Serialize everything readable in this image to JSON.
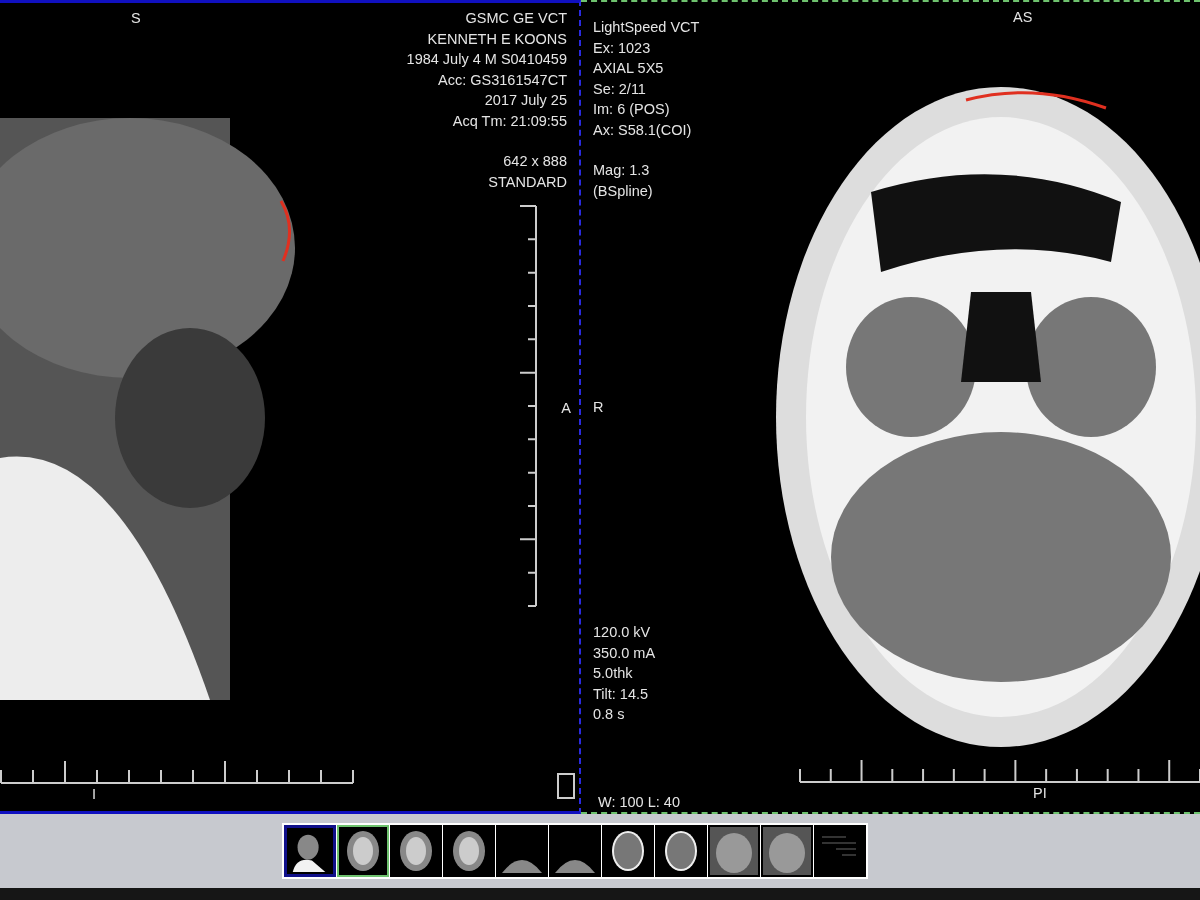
{
  "viewports": [
    {
      "kind": "xray",
      "selected": true,
      "orientation": [
        {
          "kind": "top",
          "text": "S"
        },
        {
          "kind": "right",
          "text": "A"
        },
        {
          "kind": "bottom",
          "text": "I"
        }
      ],
      "info_groups": [
        [
          "GSMC GE VCT",
          "KENNETH E KOONS",
          "1984 July 4 M S0410459",
          "Acc: GS3161547CT",
          "2017 July 25",
          "Acq Tm: 21:09:55"
        ],
        [
          "642 x 888",
          "STANDARD"
        ]
      ]
    },
    {
      "kind": "ct",
      "selected": false,
      "orientation": [
        {
          "kind": "top",
          "text": "AS"
        },
        {
          "kind": "left",
          "text": "R"
        },
        {
          "kind": "bottom",
          "text": "PI"
        }
      ],
      "info_groups": [
        [
          "LightSpeed VCT",
          "Ex: 1023",
          "AXIAL 5X5",
          "Se: 2/11",
          "Im: 6 (POS)",
          "Ax: S58.1(COI)"
        ],
        [
          "Mag: 1.3",
          "(BSpline)"
        ]
      ],
      "bottom_info": [
        "120.0 kV",
        "350.0 mA",
        "5.0thk",
        "Tilt: 14.5",
        "0.8 s"
      ],
      "window_level": "W: 100 L: 40"
    }
  ],
  "thumbnails": [
    {
      "kind": "lateral",
      "selected": true,
      "current": false
    },
    {
      "kind": "brain",
      "selected": false,
      "current": true
    },
    {
      "kind": "brain",
      "selected": false,
      "current": false
    },
    {
      "kind": "brain",
      "selected": false,
      "current": false
    },
    {
      "kind": "neck",
      "selected": false,
      "current": false
    },
    {
      "kind": "neck",
      "selected": false,
      "current": false
    },
    {
      "kind": "head",
      "selected": false,
      "current": false
    },
    {
      "kind": "head",
      "selected": false,
      "current": false
    },
    {
      "kind": "face",
      "selected": false,
      "current": false
    },
    {
      "kind": "face",
      "selected": false,
      "current": false
    },
    {
      "kind": "report",
      "selected": false,
      "current": false
    }
  ]
}
